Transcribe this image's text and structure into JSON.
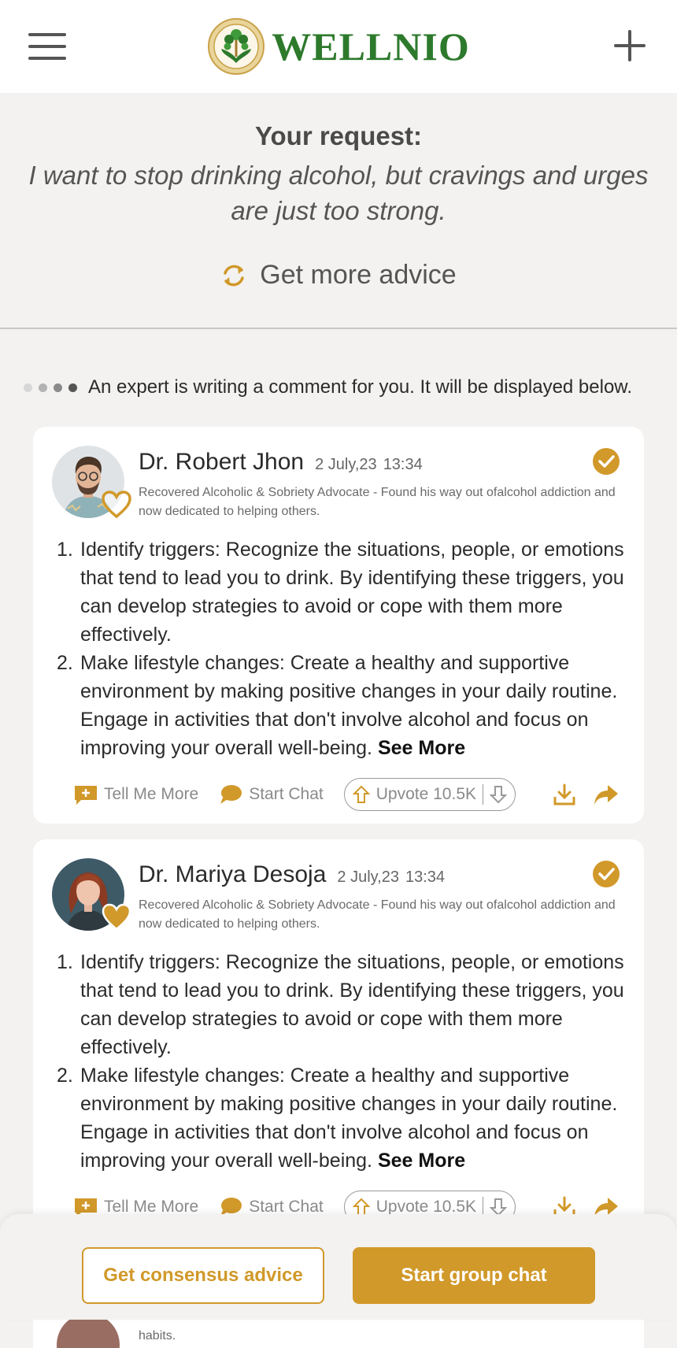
{
  "brand": {
    "name": "WELLNIO",
    "logo_icon": "tree-of-life-logo"
  },
  "colors": {
    "accent": "#d1992a",
    "brand_green": "#2d7a2c"
  },
  "request": {
    "title": "Your request:",
    "text": "I want to stop drinking alcohol, but cravings and urges are just too strong.",
    "more_advice_label": "Get more advice"
  },
  "typing_notice": "An expert is writing a comment for you. It will be displayed below.",
  "comments": [
    {
      "name": "Dr. Robert Jhon",
      "date": "2 July,23",
      "time": "13:34",
      "bio": "Recovered Alcoholic & Sobriety Advocate - Found his way out ofalcohol addiction and now dedicated to helping others.",
      "favorited": false,
      "items": [
        {
          "num": "1.",
          "text": "Identify triggers: Recognize the situations, people, or emotions that tend to lead you to drink. By identifying these triggers, you can develop strategies to avoid or cope with them more effectively."
        },
        {
          "num": "2.",
          "text": "Make lifestyle changes: Create a healthy and supportive environment by making positive changes in your daily routine. Engage in activities that don't involve alcohol and focus on improving your overall well-being."
        }
      ],
      "see_more": "See More",
      "tell_more": "Tell Me More",
      "start_chat": "Start Chat",
      "upvote": "Upvote 10.5K"
    },
    {
      "name": "Dr. Mariya Desoja",
      "date": "2 July,23",
      "time": "13:34",
      "bio": "Recovered Alcoholic & Sobriety Advocate - Found his way out ofalcohol addiction and now dedicated to helping others.",
      "favorited": true,
      "items": [
        {
          "num": "1.",
          "text": "Identify triggers: Recognize the situations, people, or emotions that tend to lead you to drink. By identifying these triggers, you can develop strategies to avoid or cope with them more effectively."
        },
        {
          "num": "2.",
          "text": "Make lifestyle changes: Create a healthy and supportive environment by making positive changes in your daily routine. Engage in activities that don't involve alcohol and focus on improving your overall well-being."
        }
      ],
      "see_more": "See More",
      "tell_more": "Tell Me More",
      "start_chat": "Start Chat",
      "upvote": "Upvote 10.5K"
    }
  ],
  "peek_text": "habits.",
  "bottom": {
    "consensus_label": "Get consensus advice",
    "group_chat_label": "Start group chat"
  }
}
